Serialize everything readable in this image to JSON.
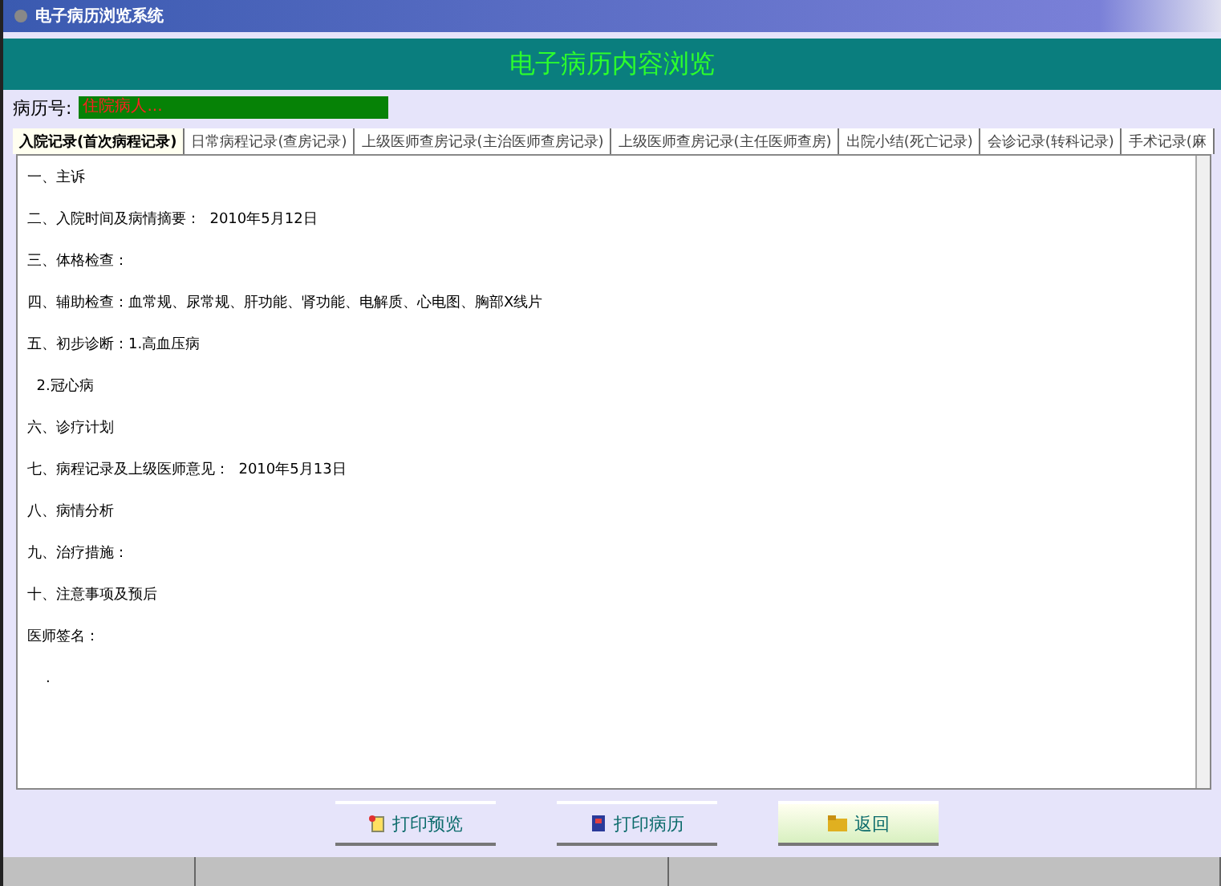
{
  "window": {
    "title": "电子病历浏览系统"
  },
  "header": {
    "title": "电子病历内容浏览"
  },
  "record": {
    "label": "病历号:",
    "value": "住院病人..."
  },
  "tabs": [
    {
      "label": "入院记录(首次病程记录)",
      "selected": true
    },
    {
      "label": "日常病程记录(查房记录)",
      "selected": false
    },
    {
      "label": "上级医师查房记录(主治医师查房记录)",
      "selected": false
    },
    {
      "label": "上级医师查房记录(主任医师查房)",
      "selected": false
    },
    {
      "label": "出院小结(死亡记录)",
      "selected": false
    },
    {
      "label": "会诊记录(转科记录)",
      "selected": false
    },
    {
      "label": "手术记录(麻",
      "selected": false
    }
  ],
  "content": {
    "lines": [
      "一、主诉",
      "二、入院时间及病情摘要：  2010年5月12日",
      "三、体格检查：",
      "四、辅助检查：血常规、尿常规、肝功能、肾功能、电解质、心电图、胸部X线片",
      "五、初步诊断：1.高血压病",
      "  2.冠心病",
      "六、诊疗计划",
      "七、病程记录及上级医师意见：  2010年5月13日",
      "八、病情分析",
      "九、治疗措施：",
      "十、注意事项及预后",
      "医师签名：",
      "    ."
    ]
  },
  "buttons": [
    {
      "kind": "preview",
      "label": "打印预览",
      "selected": false
    },
    {
      "kind": "print",
      "label": "打印病历",
      "selected": false
    },
    {
      "kind": "back",
      "label": "返回",
      "selected": true
    }
  ],
  "status_bar": {
    "cells": [
      "",
      "",
      ""
    ]
  }
}
